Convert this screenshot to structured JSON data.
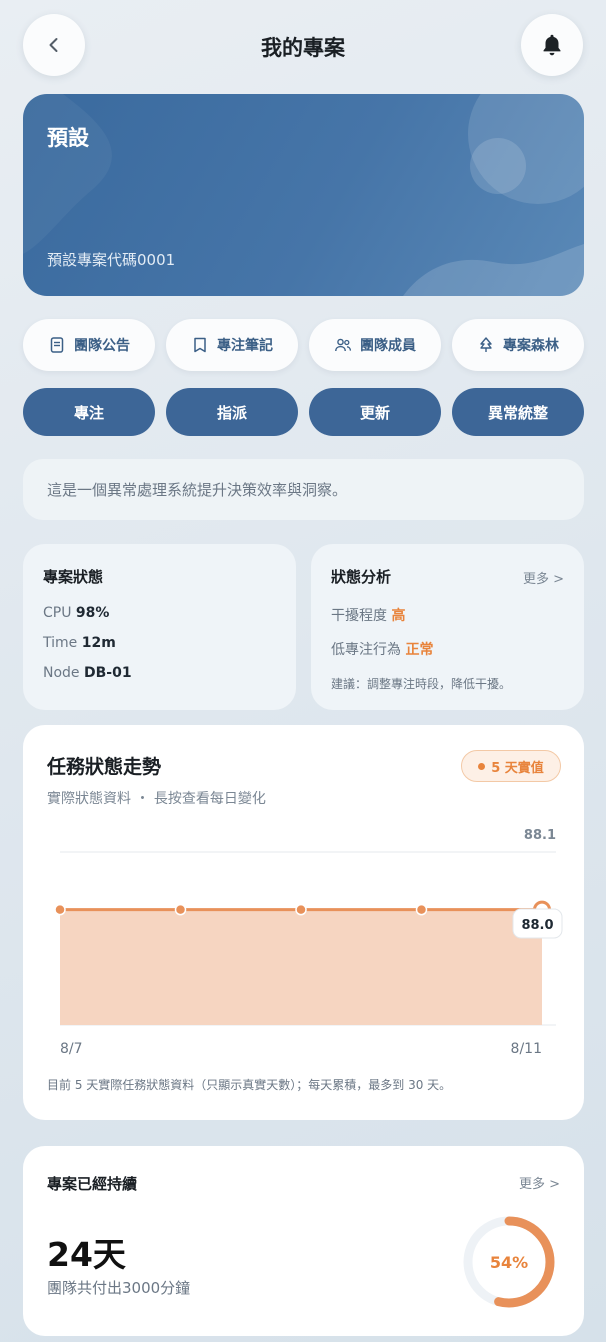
{
  "header": {
    "title": "我的專案",
    "back_icon": "chevron-left-icon",
    "bell_icon": "bell-icon"
  },
  "hero": {
    "title": "預設",
    "code": "預設專案代碼0001"
  },
  "tools": [
    {
      "label": "團隊公告",
      "icon": "document-icon"
    },
    {
      "label": "專注筆記",
      "icon": "book-icon"
    },
    {
      "label": "團隊成員",
      "icon": "users-icon"
    },
    {
      "label": "專案森林",
      "icon": "tree-icon"
    }
  ],
  "actions": [
    "專注",
    "指派",
    "更新",
    "異常統整"
  ],
  "description": "這是一個異常處理系統提升決策效率與洞察。",
  "project_status": {
    "title": "專案狀態",
    "cpu_label": "CPU",
    "cpu_value": "98%",
    "time_label": "Time",
    "time_value": "12m",
    "node_label": "Node",
    "node_value": "DB-01"
  },
  "status_analysis": {
    "title": "狀態分析",
    "more": "更多 >",
    "interference_label": "干擾程度",
    "interference_value": "高",
    "low_focus_label": "低專注行為",
    "low_focus_value": "正常",
    "advice": "建議：調整專注時段，降低干擾。"
  },
  "trend": {
    "title": "任務狀態走勢",
    "subtitle": "實際狀態資料 ・ 長按查看每日變化",
    "badge": "5 天實值",
    "footnote": "目前 5 天實際任務狀態資料（只顯示真實天數）；每天累積，最多到 30 天。",
    "tooltip": "88.0"
  },
  "chart_data": {
    "type": "area",
    "x": [
      "8/7",
      "8/8",
      "8/9",
      "8/10",
      "8/11"
    ],
    "x_tick_labels": [
      "8/7",
      "8/11"
    ],
    "values": [
      88.0,
      88.0,
      88.0,
      88.0,
      88.0
    ],
    "y_tick_labels": [
      "88.1"
    ],
    "ylim": [
      87.8,
      88.1
    ],
    "grid": true,
    "color": "#e8915a",
    "fill": "#f6d5c1"
  },
  "duration": {
    "title": "專案已經持續",
    "more": "更多 >",
    "days": "24天",
    "paid": "團隊共付出3000分鐘",
    "percent_label": "54%",
    "percent": 0.54
  },
  "colors": {
    "primary": "#3d6697",
    "accent": "#e8843c"
  }
}
